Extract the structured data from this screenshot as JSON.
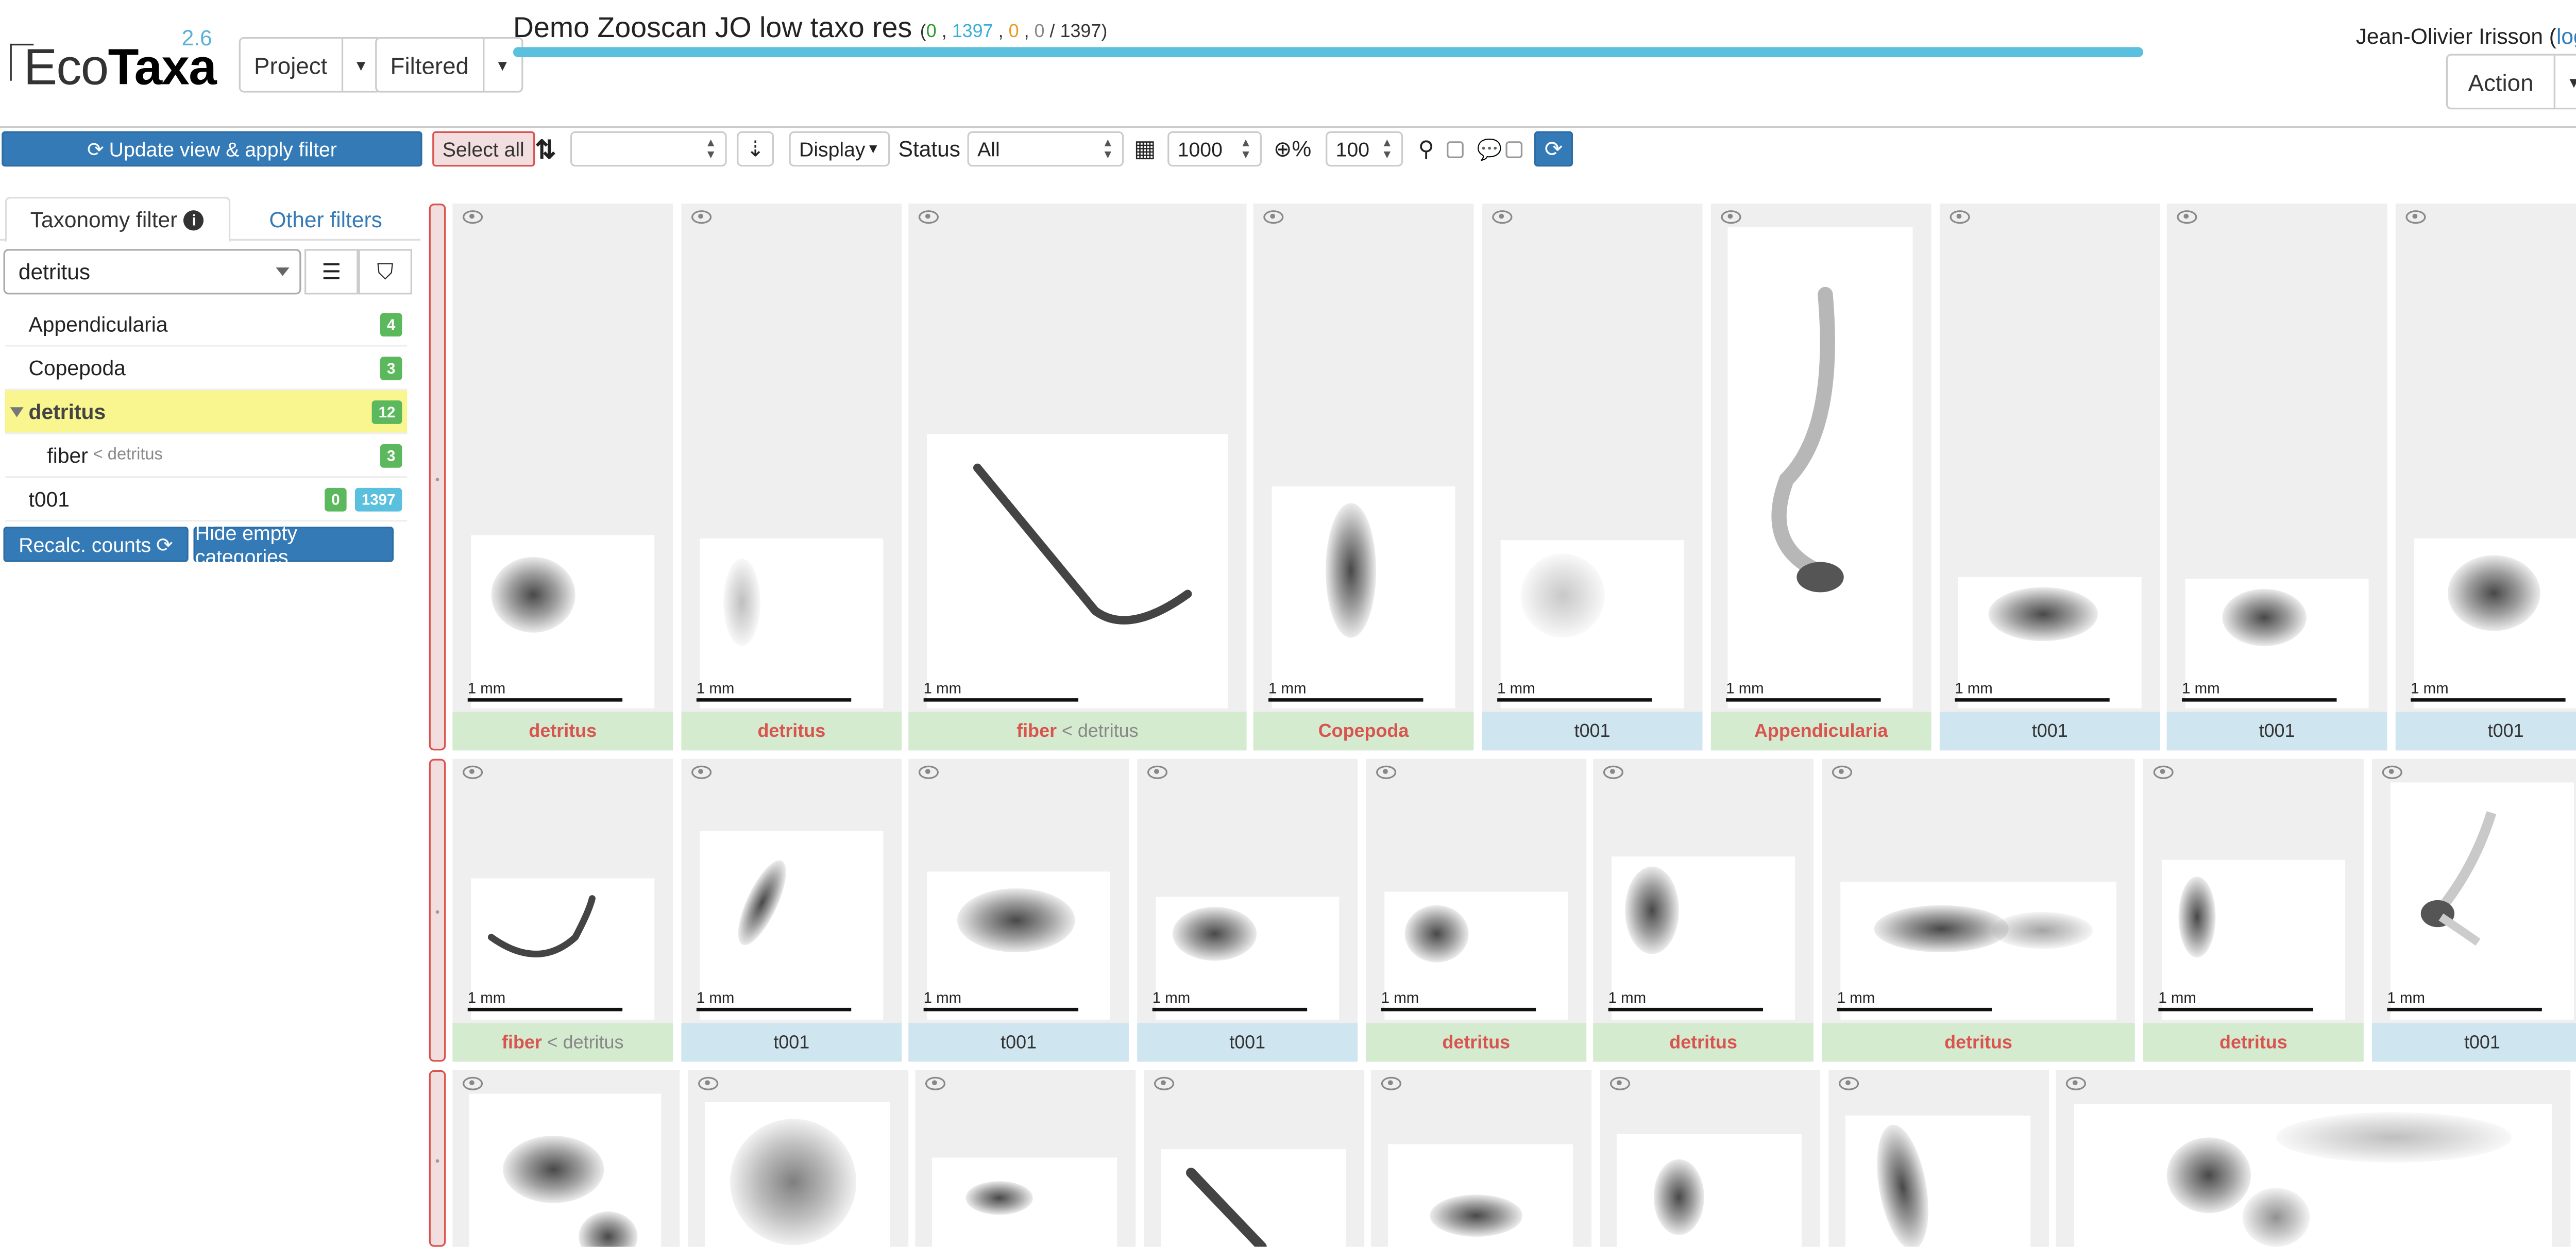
{
  "app": {
    "logo_text_light": "Eco",
    "logo_text_bold": "Taxa",
    "version": "2.6",
    "project_menu": "Project",
    "filtered_menu": "Filtered",
    "project_title": "Demo Zooscan JO low taxo res",
    "counts": {
      "open": "(",
      "validated": "0",
      "sep1": " , ",
      "predicted": "1397",
      "sep2": " , ",
      "dubious": "0",
      "sep3": " , ",
      "other": "0",
      "total": " / 1397)"
    },
    "progress_fraction": 1.0,
    "user_name": "Jean-Olivier Irisson",
    "logout_open": " (",
    "logout_label": "log out",
    "logout_close": ")",
    "action_menu": "Action"
  },
  "toolbar": {
    "update_label": "Update view & apply filter",
    "select_all": "Select all",
    "sort_value": "",
    "display_label": "Display",
    "status_label": "Status",
    "status_value": "All",
    "page_size": "1000",
    "zoom_suffix": "%",
    "zoom_value": "100"
  },
  "sidebar": {
    "tab_taxonomy": "Taxonomy filter",
    "tab_other": "Other filters",
    "filter_value": "detritus",
    "tree": [
      {
        "label": "Appendicularia",
        "count": "4"
      },
      {
        "label": "Copepoda",
        "count": "3"
      },
      {
        "label": "detritus",
        "count": "12"
      },
      {
        "label": "fiber",
        "parent": "< detritus",
        "count": "3"
      },
      {
        "label": "t001",
        "count_validated": "0",
        "count_predicted": "1397"
      }
    ],
    "recalc_label": "Recalc. counts",
    "hide_empty_label": "Hide empty categories"
  },
  "grid": {
    "scale_label": "1 mm",
    "row1": [
      {
        "label": "detritus",
        "status": "validated"
      },
      {
        "label": "detritus",
        "status": "validated"
      },
      {
        "label": "fiber",
        "parent": "< detritus",
        "status": "validated"
      },
      {
        "label": "Copepoda",
        "status": "validated"
      },
      {
        "label": "t001",
        "status": "predicted"
      },
      {
        "label": "Appendicularia",
        "status": "validated"
      },
      {
        "label": "t001",
        "status": "predicted"
      },
      {
        "label": "t001",
        "status": "predicted"
      },
      {
        "label": "t001",
        "status": "predicted"
      }
    ],
    "row2": [
      {
        "label": "fiber",
        "parent": "< detritus",
        "status": "validated"
      },
      {
        "label": "t001",
        "status": "predicted"
      },
      {
        "label": "t001",
        "status": "predicted"
      },
      {
        "label": "t001",
        "status": "predicted"
      },
      {
        "label": "detritus",
        "status": "validated"
      },
      {
        "label": "detritus",
        "status": "validated"
      },
      {
        "label": "detritus",
        "status": "validated"
      },
      {
        "label": "detritus",
        "status": "validated"
      },
      {
        "label": "t001",
        "status": "predicted"
      }
    ]
  },
  "colors": {
    "primary": "#337ab7",
    "validated_bg": "#d4ebcf",
    "validated_text": "#d9534f",
    "predicted_bg": "#cfe5ef",
    "selected_bg": "#faf68f",
    "progress": "#5bc0de"
  },
  "icons": [
    "refresh-icon",
    "sort-icon",
    "sort-alpha-icon",
    "grid-icon",
    "zoom-icon",
    "search-icon",
    "comment-icon",
    "info-icon",
    "list-icon",
    "tags-icon",
    "eye-icon",
    "chevron-down-icon"
  ]
}
